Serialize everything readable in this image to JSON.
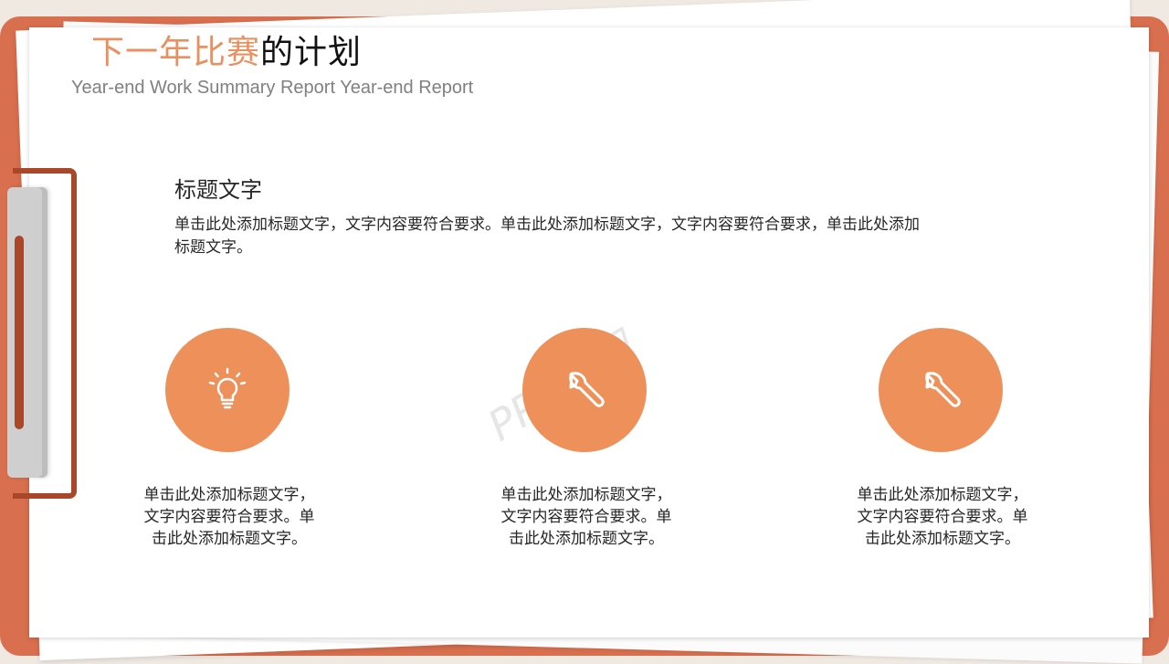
{
  "slide": {
    "title_highlight": "下一年比赛",
    "title_rest": "的计划",
    "subtitle": "Year-end Work Summary Report Year-end Report"
  },
  "section": {
    "heading": "标题文字",
    "body_line1": "单击此处添加标题文字，文字内容要符合要求。单击此处添加标题文字，文字内容要符合要求，单击此处添加",
    "body_line2": "标题文字。"
  },
  "features": [
    {
      "icon": "lightbulb-icon",
      "line1": "单击此处添加标题文字，",
      "line2": "文字内容要符合要求。单",
      "line3": "击此处添加标题文字。"
    },
    {
      "icon": "wrench-icon",
      "line1": "单击此处添加标题文字，",
      "line2": "文字内容要符合要求。单",
      "line3": "击此处添加标题文字。"
    },
    {
      "icon": "wrench-icon",
      "line1": "单击此处添加标题文字，",
      "line2": "文字内容要符合要求。单",
      "line3": "击此处添加标题文字。"
    }
  ],
  "watermark": "PPT家园",
  "colors": {
    "accent": "#ee9059",
    "board": "#d86f4e",
    "clip": "#a8472a"
  }
}
